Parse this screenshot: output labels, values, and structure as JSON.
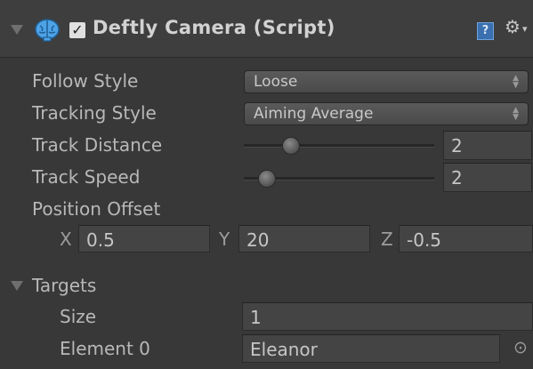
{
  "component": {
    "title": "Deftly Camera (Script)",
    "enabled_check": "✓",
    "help_glyph": "?",
    "gear_glyph": "⚙",
    "gear_menu_glyph": "▾"
  },
  "fields": {
    "follow_style": {
      "label": "Follow Style",
      "value": "Loose"
    },
    "tracking_style": {
      "label": "Tracking Style",
      "value": "Aiming Average"
    },
    "track_distance": {
      "label": "Track Distance",
      "value": "2",
      "slider_fraction": 0.22
    },
    "track_speed": {
      "label": "Track Speed",
      "value": "2",
      "slider_fraction": 0.08
    },
    "position_offset": {
      "label": "Position Offset",
      "x_label": "X",
      "x_value": "0.5",
      "y_label": "Y",
      "y_value": "20",
      "z_label": "Z",
      "z_value": "-0.5"
    }
  },
  "targets": {
    "label": "Targets",
    "size_label": "Size",
    "size_value": "1",
    "element0_label": "Element 0",
    "element0_value": "Eleanor",
    "picker_glyph": "⊙"
  },
  "icons": {
    "foldout": "foldout-arrow-icon",
    "script": "brain-script-icon",
    "help": "help-book-icon",
    "settings": "gear-icon",
    "dropdown": "dropdown-arrows-icon",
    "picker": "object-picker-icon"
  },
  "colors": {
    "background": "#383838",
    "header": "#3e3e3e",
    "script_icon": "#4ea3e6",
    "help_icon": "#3a6fb0"
  }
}
